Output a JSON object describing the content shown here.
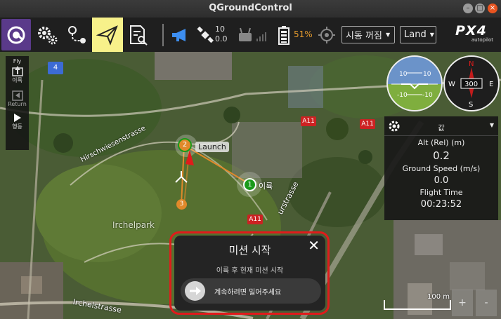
{
  "window": {
    "title": "QGroundControl"
  },
  "toolbar": {
    "gps_count": "10",
    "gps_hdop": "0.0",
    "battery_percent": "51%",
    "flight_mode": "시동 꺼짐",
    "action_mode": "Land",
    "brand_line1": "PX4",
    "brand_line2": "autopilot"
  },
  "flytools": {
    "header": "Fly",
    "items": [
      {
        "label": "이륙"
      },
      {
        "label": "Return"
      },
      {
        "label": "행동"
      }
    ]
  },
  "instruments": {
    "selector_label": "값",
    "compass_heading": "300",
    "attitude_marks": [
      "10",
      "10",
      "-10",
      "-10"
    ],
    "compass_letters": [
      "N",
      "E",
      "S",
      "W"
    ],
    "values": [
      {
        "label": "Alt (Rel) (m)",
        "value": "0.2"
      },
      {
        "label": "Ground Speed (m/s)",
        "value": "0.0"
      },
      {
        "label": "Flight Time",
        "value": "00:23:52"
      }
    ]
  },
  "map": {
    "labels": {
      "park": "Irchelpark",
      "street1": "Hirschwiesenstrasse",
      "street2": "Irchelstrasse",
      "street3": "urstrasse",
      "road_a11_1": "A11",
      "road_a11_2": "A11",
      "road_a11_3": "A11",
      "route_4": "4"
    },
    "waypoints": {
      "launch_label": "Launch",
      "wp1_num": "1",
      "wp1_label": "이륙",
      "wp2_num": "2",
      "wp3_num": "3"
    },
    "scale_label": "100 m",
    "zoom_in": "+",
    "zoom_out": "-"
  },
  "dialog": {
    "title": "미션 시작",
    "subtitle": "이륙 후 현재 미션 시작",
    "slider_text": "계속하려면 밀어주세요"
  },
  "colors": {
    "accent_purple": "#5a3a8a",
    "plan_highlight": "#f7f18a",
    "highlight_red": "#e01b1b",
    "battery_orange": "#e59b2e",
    "waypoint_orange": "#e0892a",
    "waypoint_green": "#1a9a1a"
  }
}
